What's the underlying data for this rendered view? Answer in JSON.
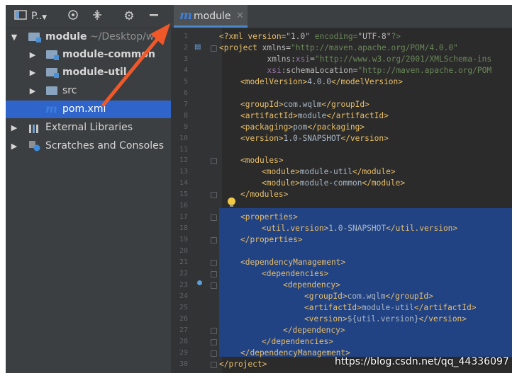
{
  "sidebar": {
    "toolbar": {
      "project_dropdown_label": "P..",
      "target_icon": "crosshair-icon",
      "collapse_icon": "collapse-icon",
      "settings_icon": "gear-icon",
      "hide_icon": "minus-icon"
    },
    "tree": [
      {
        "label": "module",
        "path": "~/Desktop/w",
        "expanded": true,
        "icon": "module-folder-icon"
      },
      {
        "label": "module-common",
        "expanded": false,
        "icon": "module-folder-icon"
      },
      {
        "label": "module-util",
        "expanded": false,
        "icon": "module-folder-icon"
      },
      {
        "label": "src",
        "expanded": false,
        "icon": "folder-icon"
      },
      {
        "label": "pom.xml",
        "selected": true,
        "icon": "maven-icon"
      },
      {
        "label": "External Libraries",
        "expanded": false,
        "icon": "libraries-icon"
      },
      {
        "label": "Scratches and Consoles",
        "expanded": false,
        "icon": "scratches-icon"
      }
    ]
  },
  "editor": {
    "tab": {
      "label": "module",
      "icon": "maven-icon",
      "close_icon": "close-icon"
    },
    "line_numbers": [
      "1",
      "2",
      "3",
      "4",
      "5",
      "6",
      "7",
      "8",
      "9",
      "10",
      "11",
      "12",
      "13",
      "14",
      "15",
      "16",
      "17",
      "18",
      "19",
      "20",
      "21",
      "22",
      "23",
      "24",
      "25",
      "26",
      "27",
      "28",
      "29",
      "30"
    ],
    "selection": {
      "from_line": 17,
      "to_line": 29
    },
    "lines": {
      "l1": [
        "<?xml version=",
        "\"1.0\"",
        " encoding=",
        "\"UTF-8\"",
        "?>"
      ],
      "l2": [
        "<project ",
        "xmlns=",
        "\"http://maven.apache.org/POM/4.0.0\""
      ],
      "l3": [
        "xmlns:",
        "xsi",
        "=",
        "\"http://www.w3.org/2001/XMLSchema-ins"
      ],
      "l4": [
        "xsi",
        ":schemaLocation=",
        "\"http://maven.apache.org/POM"
      ],
      "l5": [
        "<modelVersion>",
        "4.0.0",
        "</modelVersion>"
      ],
      "l7": [
        "<groupId>",
        "com.wqlm",
        "</groupId>"
      ],
      "l8": [
        "<artifactId>",
        "module",
        "</artifactId>"
      ],
      "l9": [
        "<packaging>",
        "pom",
        "</packaging>"
      ],
      "l10": [
        "<version>",
        "1.0-SNAPSHOT",
        "</version>"
      ],
      "l12": [
        "<modules>"
      ],
      "l13": [
        "<module>",
        "module-util",
        "</module>"
      ],
      "l14": [
        "<module>",
        "module-common",
        "</module>"
      ],
      "l15": [
        "</modules>"
      ],
      "l17": [
        "<properties>"
      ],
      "l18": [
        "<util.version>",
        "1.0-SNAPSHOT",
        "</util.version>"
      ],
      "l19": [
        "</properties>"
      ],
      "l21": [
        "<dependencyManagement>"
      ],
      "l22": [
        "<dependencies>"
      ],
      "l23": [
        "<dependency>"
      ],
      "l24": [
        "<groupId>",
        "com.wqlm",
        "</groupId>"
      ],
      "l25": [
        "<artifactId>",
        "module-util",
        "</artifactId>"
      ],
      "l26": [
        "<version>",
        "${util.version}",
        "</version>"
      ],
      "l27": [
        "</dependency>"
      ],
      "l28": [
        "</dependencies>"
      ],
      "l29": [
        "</dependencyManagement>"
      ],
      "l30": [
        "</project>"
      ]
    }
  },
  "annotation": {
    "arrow_color": "#f0582a"
  },
  "watermark": "https://blog.csdn.net/qq_44336097",
  "colors": {
    "selection": "#214283",
    "selected_row": "#2f65ca",
    "tag": "#e8bf6a",
    "string": "#6a8759",
    "namespace": "#9876aa"
  }
}
